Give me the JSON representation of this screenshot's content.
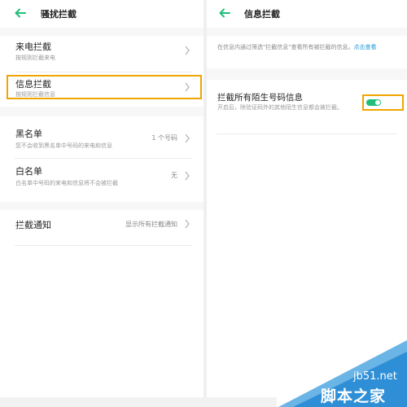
{
  "left": {
    "header": {
      "title": "骚扰拦截"
    },
    "items": [
      {
        "title": "来电拦截",
        "subtitle": "按规则拦截来电",
        "value": ""
      },
      {
        "title": "信息拦截",
        "subtitle": "按规则拦截信息",
        "value": ""
      },
      {
        "title": "黑名单",
        "subtitle": "您不会收到黑名单中号码的来电和信息",
        "value": "1 个号码"
      },
      {
        "title": "白名单",
        "subtitle": "白名单中号码的来电和信息将不会被拦截",
        "value": "无"
      },
      {
        "title": "拦截通知",
        "subtitle": "",
        "value": "显示所有拦截通知"
      }
    ]
  },
  "right": {
    "header": {
      "title": "信息拦截"
    },
    "info_text": "在信息内通过筛选\"拦截信息\"查看所有被拦截的信息。",
    "info_link": "点击查看",
    "toggle": {
      "title": "拦截所有陌生号码信息",
      "subtitle": "开启后，除验证码外的其他陌生信息都会被拦截。",
      "state": "on"
    }
  },
  "watermark": {
    "url": "jb51.net",
    "text": "脚本之家"
  },
  "colors": {
    "accent": "#1fbf7a",
    "highlight": "#f0a500",
    "link": "#2196d8"
  },
  "icons": {
    "back": "arrow-left-icon",
    "chevron": "chevron-right-icon"
  }
}
